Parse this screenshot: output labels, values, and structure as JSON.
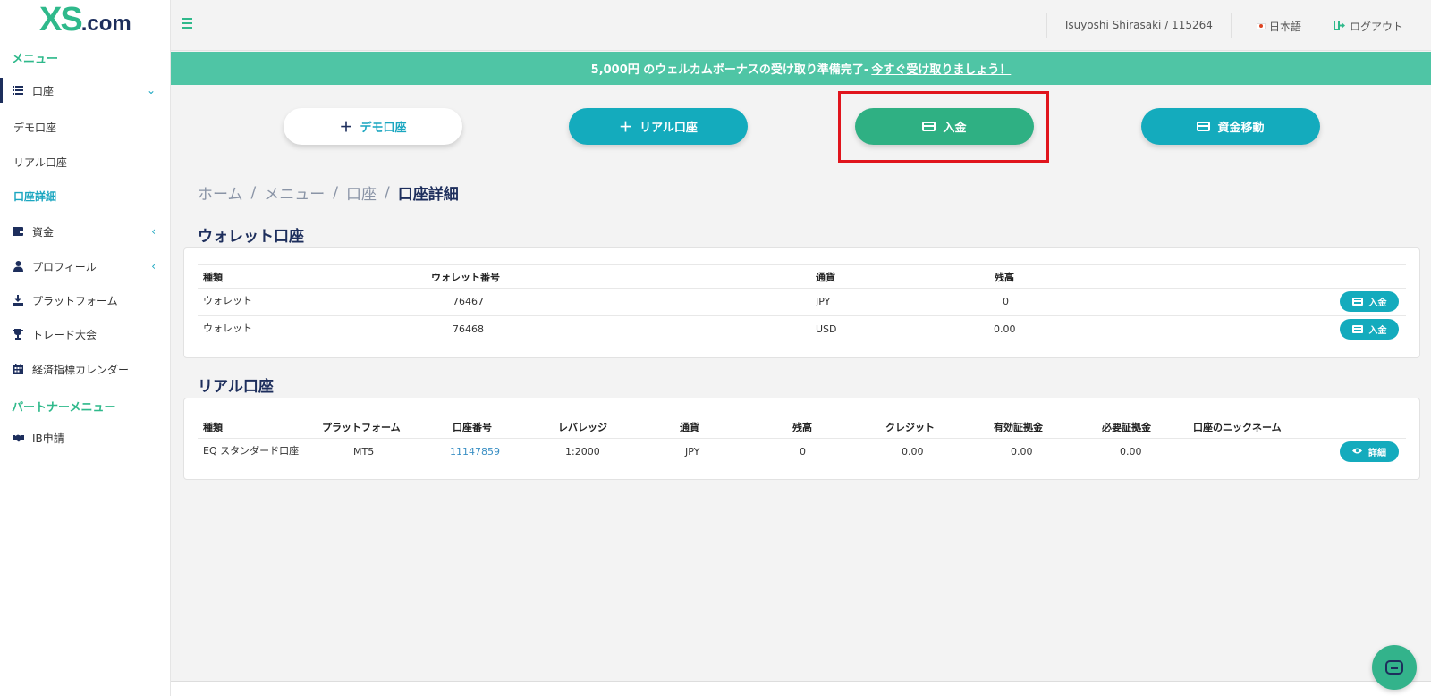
{
  "brand": {
    "logo_main": "XS",
    "logo_suffix": ".com"
  },
  "sidebar": {
    "menu_heading": "メニュー",
    "accounts_label": "口座",
    "demo_account": "デモ口座",
    "real_account": "リアル口座",
    "account_details": "口座詳細",
    "funds": "資金",
    "profile": "プロフィール",
    "platform": "プラットフォーム",
    "trade_contest": "トレード大会",
    "econ_calendar": "経済指標カレンダー",
    "partner_heading": "パートナーメニュー",
    "ib_apply": "IB申請"
  },
  "topbar": {
    "user": "Tsuyoshi Shirasaki / 115264",
    "language": "日本語",
    "logout": "ログアウト"
  },
  "banner": {
    "text": "5,000円 のウェルカムボーナスの受け取り準備完了- ",
    "link": "今すぐ受け取りましょう！"
  },
  "actions": {
    "demo": "デモ口座",
    "real": "リアル口座",
    "deposit": "入金",
    "transfer": "資金移動"
  },
  "breadcrumb": {
    "home": "ホーム",
    "menu": "メニュー",
    "account": "口座",
    "current": "口座詳細"
  },
  "wallet": {
    "title": "ウォレット口座",
    "headers": [
      "種類",
      "ウォレット番号",
      "通貨",
      "残高"
    ],
    "rows": [
      {
        "type": "ウォレット",
        "number": "76467",
        "currency": "JPY",
        "balance": "0",
        "action": "入金"
      },
      {
        "type": "ウォレット",
        "number": "76468",
        "currency": "USD",
        "balance": "0.00",
        "action": "入金"
      }
    ]
  },
  "real": {
    "title": "リアル口座",
    "headers": [
      "種類",
      "プラットフォーム",
      "口座番号",
      "レバレッジ",
      "通貨",
      "残高",
      "クレジット",
      "有効証拠金",
      "必要証拠金",
      "口座のニックネーム"
    ],
    "rows": [
      {
        "type": "EQ スタンダード口座",
        "platform": "MT5",
        "number": "11147859",
        "leverage": "1:2000",
        "currency": "JPY",
        "balance": "0",
        "credit": "0.00",
        "equity": "0.00",
        "margin": "0.00",
        "action": "詳細"
      }
    ]
  },
  "colors": {
    "brand_green": "#2fb98b",
    "navy": "#1d2e5c",
    "teal": "#14abbd",
    "deposit_green": "#2fb083",
    "banner": "#4fc5a5",
    "highlight_red": "#e0141c"
  }
}
